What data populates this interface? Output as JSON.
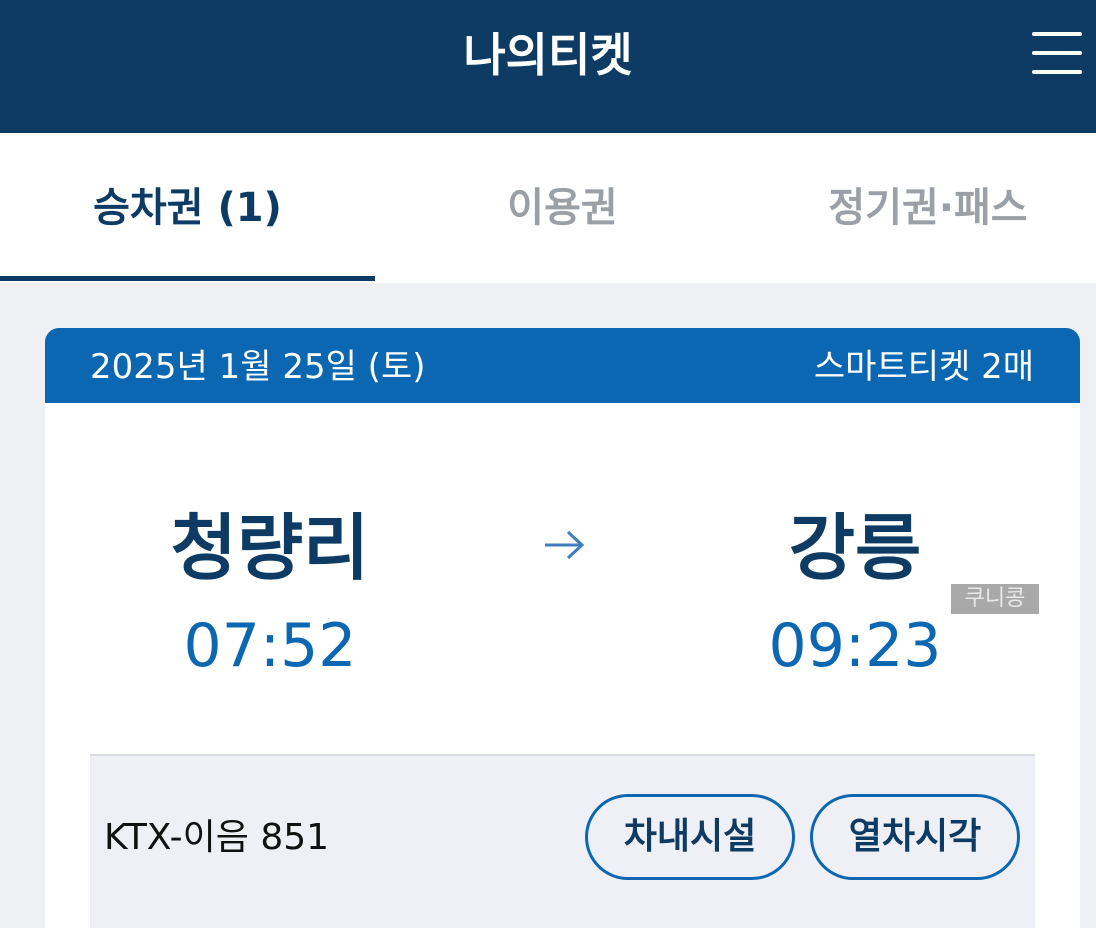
{
  "header": {
    "title": "나의티켓",
    "menu_icon": "hamburger-menu-icon"
  },
  "tabs": [
    {
      "label": "승차권 (1)",
      "active": true
    },
    {
      "label": "이용권",
      "active": false
    },
    {
      "label": "정기권·패스",
      "active": false
    }
  ],
  "ticket": {
    "date": "2025년 1월 25일 (토)",
    "ticket_type": "스마트티켓 2매",
    "departure": {
      "station": "청량리",
      "time": "07:52"
    },
    "arrival": {
      "station": "강릉",
      "time": "09:23"
    },
    "route_icon": "arrow-right-icon",
    "watermark": "쿠니콩",
    "train": "KTX-이음 851",
    "buttons": {
      "facilities": "차내시설",
      "timetable": "열차시각"
    }
  },
  "colors": {
    "header_bg": "#0d3b63",
    "accent": "#0b67b2",
    "tab_inactive": "#9aa0a6"
  }
}
